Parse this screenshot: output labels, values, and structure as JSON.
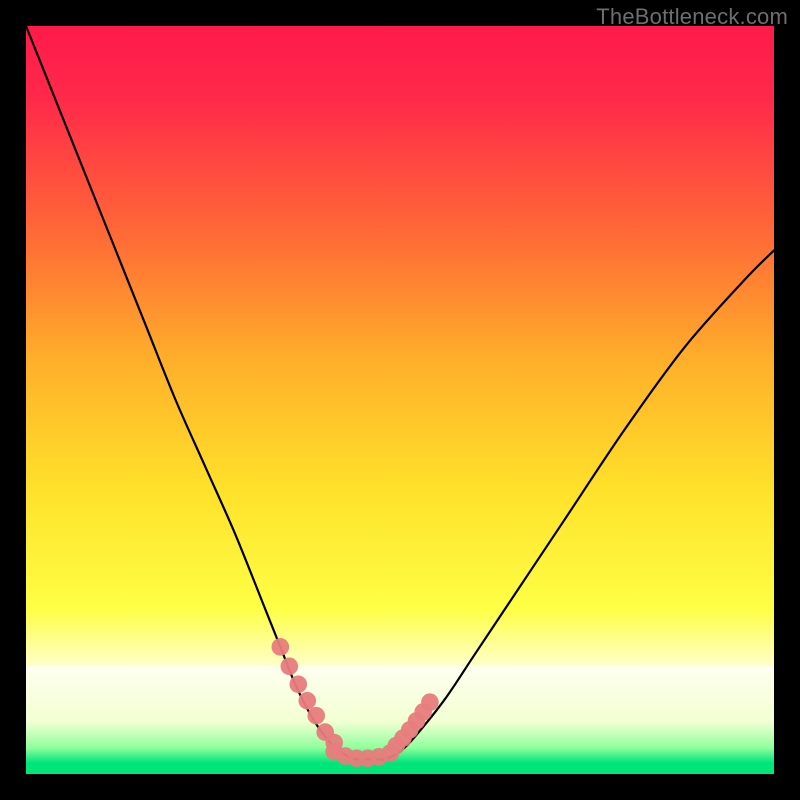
{
  "watermark": "TheBottleneck.com",
  "colors": {
    "frame": "#000000",
    "curve": "#000000",
    "marker": "#e77c7c",
    "grad_top": "#ff1a4b",
    "grad_mid_upper": "#ff8a2a",
    "grad_mid": "#ffe12a",
    "grad_pale": "#ffffc8",
    "grad_green_light": "#b8ff9c",
    "grad_green": "#00e57a"
  },
  "chart_data": {
    "type": "line",
    "title": "",
    "xlabel": "",
    "ylabel": "",
    "xlim": [
      0,
      100
    ],
    "ylim": [
      0,
      100
    ],
    "grid": false,
    "legend": false,
    "annotations": [
      "TheBottleneck.com"
    ],
    "series": [
      {
        "name": "bottleneck-curve",
        "x": [
          0,
          4,
          8,
          12,
          16,
          20,
          24,
          28,
          32,
          34,
          36,
          38,
          40,
          42,
          44,
          46,
          48,
          50,
          52,
          56,
          60,
          66,
          72,
          80,
          88,
          96,
          100
        ],
        "y": [
          100,
          90,
          80,
          70,
          60,
          50,
          41,
          32,
          22,
          17,
          12,
          8,
          5,
          3,
          2,
          2,
          2,
          3,
          5,
          10,
          16,
          25,
          34,
          46,
          57,
          66,
          70
        ]
      }
    ],
    "markers": [
      {
        "name": "highlight-left",
        "x": [
          34.0,
          35.2,
          36.4,
          37.6,
          38.8,
          40.0,
          41.2
        ],
        "y": [
          17.0,
          14.4,
          12.0,
          9.8,
          7.8,
          5.6,
          4.2
        ]
      },
      {
        "name": "highlight-bottom",
        "x": [
          41.2,
          42.7,
          44.2,
          45.7,
          47.2,
          48.7
        ],
        "y": [
          3.0,
          2.4,
          2.1,
          2.1,
          2.3,
          2.8
        ]
      },
      {
        "name": "highlight-right",
        "x": [
          49.5,
          50.4,
          51.3,
          52.2,
          53.1,
          54.0
        ],
        "y": [
          3.8,
          4.8,
          5.9,
          7.1,
          8.3,
          9.6
        ]
      }
    ]
  }
}
